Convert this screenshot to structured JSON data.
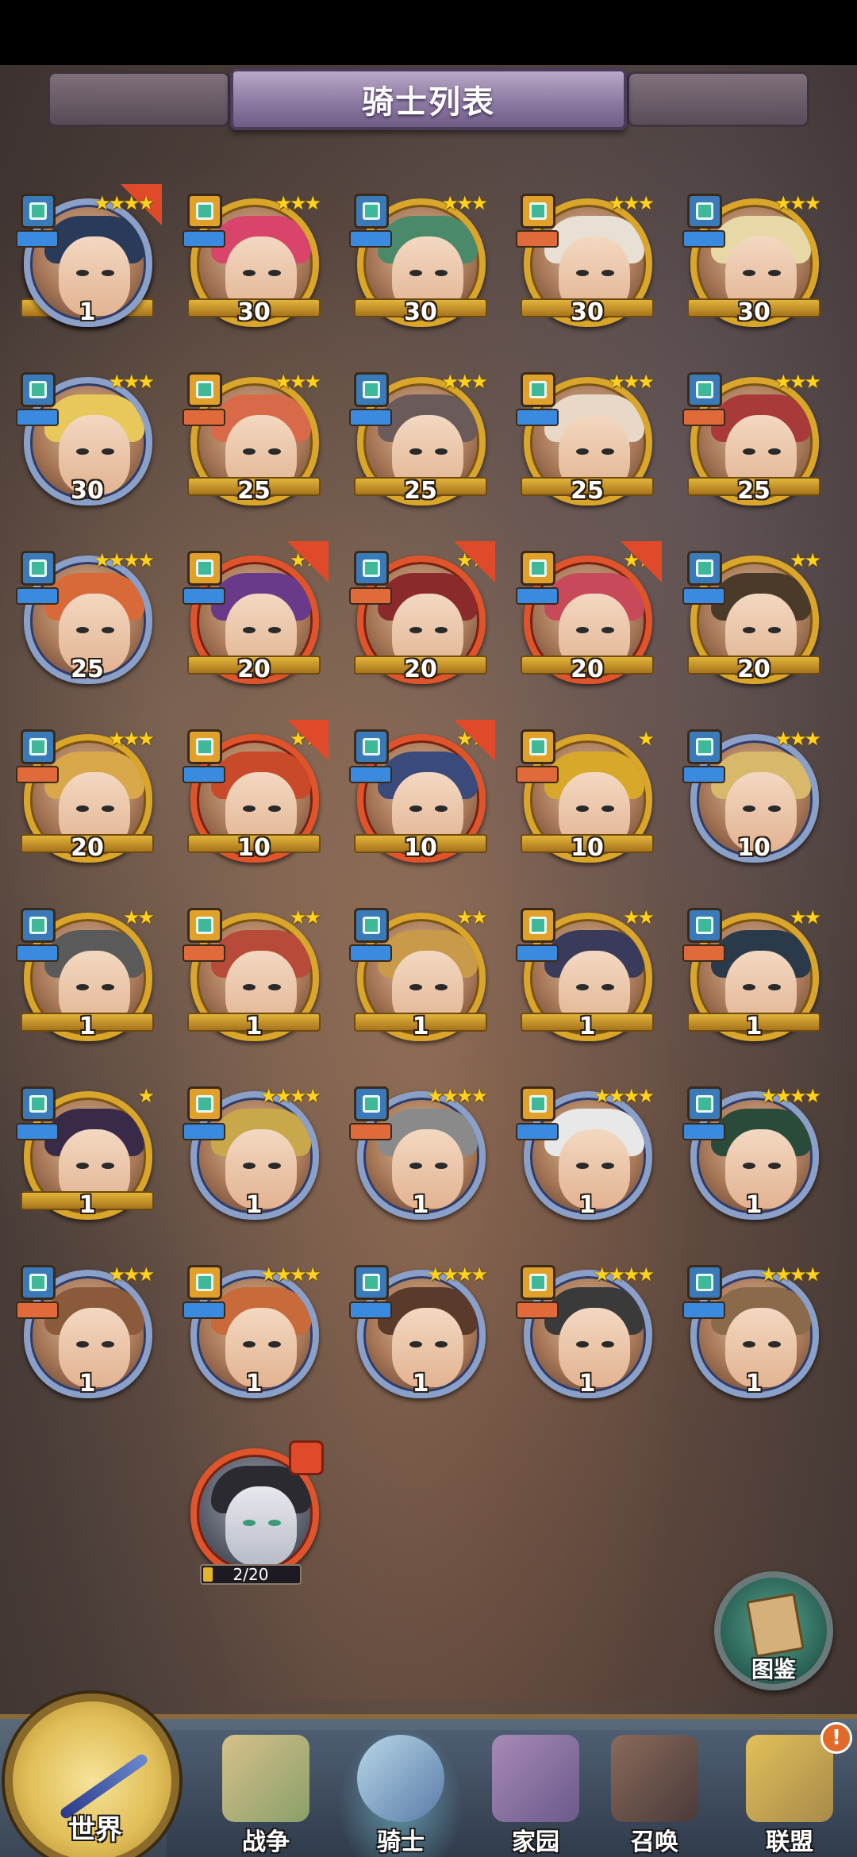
{
  "title": "骑士列表",
  "knights": [
    {
      "level": "30",
      "stars": "★★★",
      "frame": "red"
    },
    {
      "level": "30",
      "stars": "★★★",
      "frame": "gold"
    },
    {
      "level": "30",
      "stars": "★★★",
      "frame": "gold"
    },
    {
      "level": "30",
      "stars": "★★★",
      "frame": "gold"
    },
    {
      "level": "30",
      "stars": "★★★",
      "frame": "gold"
    },
    {
      "level": "30",
      "stars": "★★★",
      "frame": "blue"
    },
    {
      "level": "25",
      "stars": "★★★",
      "frame": "gold"
    },
    {
      "level": "25",
      "stars": "★★★",
      "frame": "gold"
    },
    {
      "level": "25",
      "stars": "★★★",
      "frame": "gold"
    },
    {
      "level": "25",
      "stars": "★★★",
      "frame": "gold"
    },
    {
      "level": "25",
      "stars": "★★★★",
      "frame": "blue"
    },
    {
      "level": "20",
      "stars": "★★",
      "frame": "red"
    },
    {
      "level": "20",
      "stars": "★★",
      "frame": "red"
    },
    {
      "level": "20",
      "stars": "★★",
      "frame": "red"
    },
    {
      "level": "20",
      "stars": "★★",
      "frame": "gold"
    },
    {
      "level": "20",
      "stars": "★★★",
      "frame": "gold"
    },
    {
      "level": "10",
      "stars": "★★",
      "frame": "red"
    },
    {
      "level": "10",
      "stars": "★★",
      "frame": "red"
    },
    {
      "level": "10",
      "stars": "★",
      "frame": "gold"
    },
    {
      "level": "10",
      "stars": "★★★",
      "frame": "blue"
    },
    {
      "level": "1",
      "stars": "★★",
      "frame": "gold"
    },
    {
      "level": "1",
      "stars": "★★",
      "frame": "gold"
    },
    {
      "level": "1",
      "stars": "★★",
      "frame": "gold"
    },
    {
      "level": "1",
      "stars": "★★",
      "frame": "gold"
    },
    {
      "level": "1",
      "stars": "★★",
      "frame": "gold"
    },
    {
      "level": "1",
      "stars": "★",
      "frame": "gold"
    },
    {
      "level": "1",
      "stars": "★★★★",
      "frame": "blue"
    },
    {
      "level": "1",
      "stars": "★★★★",
      "frame": "blue"
    },
    {
      "level": "1",
      "stars": "★★★★",
      "frame": "blue"
    },
    {
      "level": "1",
      "stars": "★★★★",
      "frame": "blue"
    },
    {
      "level": "1",
      "stars": "★★★",
      "frame": "blue"
    },
    {
      "level": "1",
      "stars": "★★★★",
      "frame": "blue"
    },
    {
      "level": "1",
      "stars": "★★★★",
      "frame": "blue"
    },
    {
      "level": "1",
      "stars": "★★★★",
      "frame": "blue"
    },
    {
      "level": "1",
      "stars": "★★★★",
      "frame": "blue"
    },
    {
      "level": "1",
      "stars": "★★★★",
      "frame": "blue"
    }
  ],
  "shard": {
    "progress": "2/20",
    "fraction": 0.1
  },
  "codex": {
    "label": "图鉴"
  },
  "nav": {
    "world": "世界",
    "items": [
      {
        "label": "战争",
        "icon": "map-icon"
      },
      {
        "label": "骑士",
        "icon": "knight-icon"
      },
      {
        "label": "家园",
        "icon": "house-icon"
      },
      {
        "label": "召唤",
        "icon": "train-icon"
      },
      {
        "label": "联盟",
        "icon": "castle-icon"
      }
    ],
    "alert": "!"
  },
  "colors": {
    "gold": "#d9a52a",
    "blue": "#8aa0c8",
    "red": "#e0542c",
    "teal": "#3fd0b0"
  }
}
